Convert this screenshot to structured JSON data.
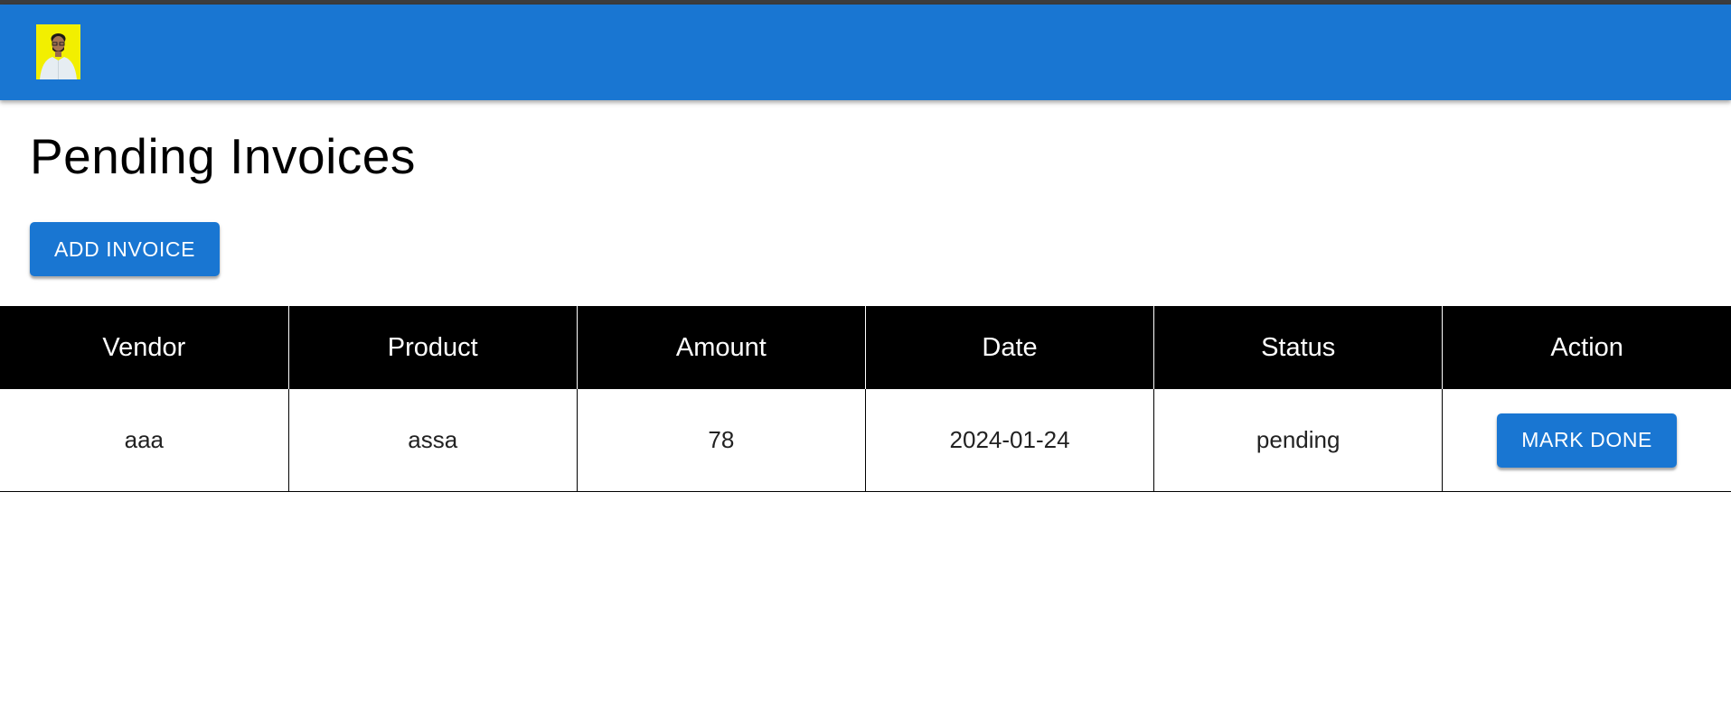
{
  "header": {
    "avatar_alt": "user avatar",
    "bar_color": "#1976d2",
    "avatar_bg": "#f2ef00"
  },
  "main": {
    "title": "Pending Invoices",
    "add_button_label": "ADD INVOICE"
  },
  "table": {
    "columns": [
      "Vendor",
      "Product",
      "Amount",
      "Date",
      "Status",
      "Action"
    ],
    "rows": [
      {
        "vendor": "aaa",
        "product": "assa",
        "amount": "78",
        "date": "2024-01-24",
        "status": "pending",
        "action_label": "MARK DONE"
      }
    ]
  }
}
